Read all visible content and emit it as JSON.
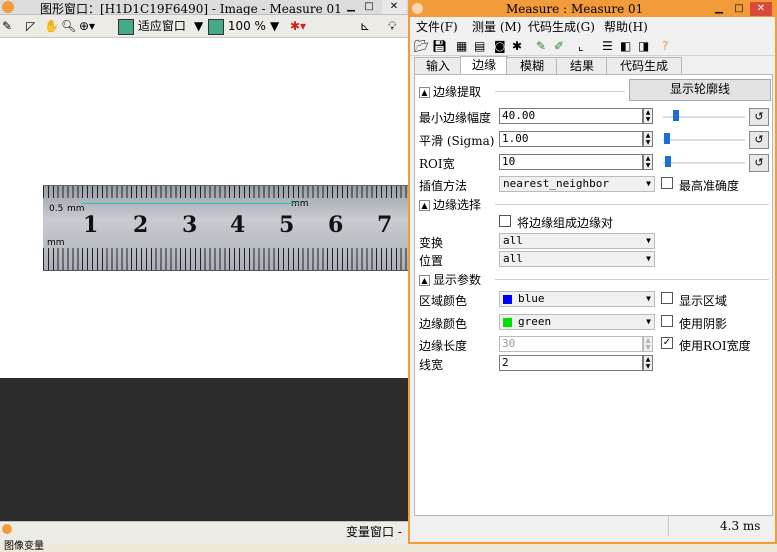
{
  "graphics_window": {
    "title": "图形窗口：[H1D1C19F6490] - Image - Measure 01",
    "toolbar": {
      "fit_label": "适应窗口",
      "zoom_label": "100 %"
    },
    "ruler": {
      "unit_top": "mm",
      "unit_bottom": "mm",
      "mark_half": "0.5",
      "numbers": [
        "1",
        "2",
        "3",
        "4",
        "5",
        "6",
        "7"
      ]
    },
    "status_left": "图像变量",
    "var_window_label": "变量窗口 -"
  },
  "dialog": {
    "title": "Measure : Measure 01",
    "menu": [
      "文件(F)",
      "测量 (M)",
      "代码生成(G)",
      "帮助(H)"
    ],
    "tabs": [
      "输入",
      "边缘",
      "模糊",
      "结果",
      "代码生成"
    ],
    "active_tab": "边缘",
    "edge_extract": {
      "header": "边缘提取",
      "show_contour_button": "显示轮廓线",
      "min_amp_label": "最小边缘幅度",
      "min_amp_value": "40.00",
      "sigma_label": "平滑 (Sigma)",
      "sigma_value": "1.00",
      "roi_label": "ROI宽",
      "roi_value": "10",
      "interp_label": "插值方法",
      "interp_value": "nearest_neighbor",
      "max_precision_label": "最高准确度"
    },
    "edge_select": {
      "header": "边缘选择",
      "pair_label": "将边缘组成边缘对",
      "transform_label": "变换",
      "transform_value": "all",
      "position_label": "位置",
      "position_value": "all"
    },
    "display": {
      "header": "显示参数",
      "region_color_label": "区域颜色",
      "region_color_value": "blue",
      "show_region_label": "显示区域",
      "edge_color_label": "边缘颜色",
      "edge_color_value": "green",
      "use_shadow_label": "使用阴影",
      "edge_length_label": "边缘长度",
      "edge_length_value": "30",
      "use_roi_width_label": "使用ROI宽度",
      "line_width_label": "线宽",
      "line_width_value": "2"
    },
    "status_time": "4.3 ms"
  },
  "colors": {
    "accent": "#f29b3b",
    "blue": "#0000ff",
    "green": "#00e000"
  }
}
